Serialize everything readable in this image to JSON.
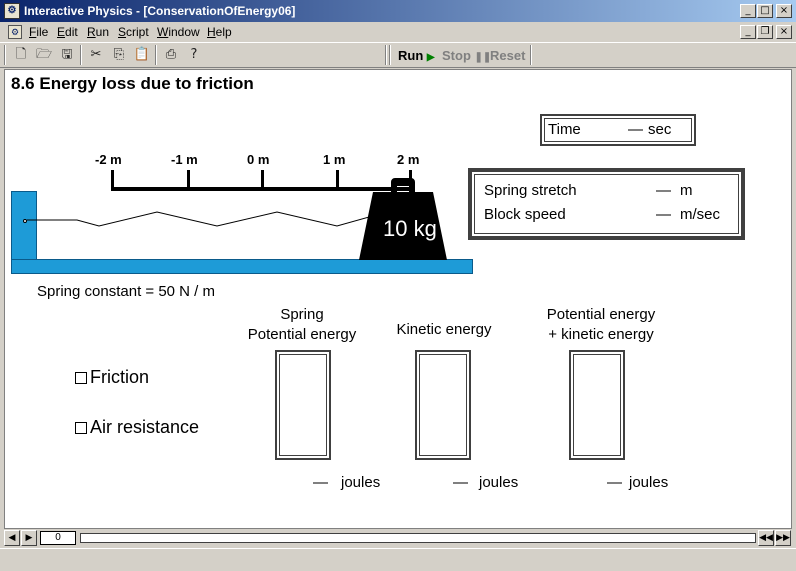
{
  "window": {
    "title": "Interactive Physics - [ConservationOfEnergy06]",
    "app_icon": "physics-app-icon",
    "controls": [
      "_",
      "□",
      "×"
    ],
    "doc_controls": [
      "_",
      "❐",
      "×"
    ]
  },
  "menu": {
    "items": [
      "File",
      "Edit",
      "Run",
      "Script",
      "Window",
      "Help"
    ]
  },
  "toolbar": {
    "icons": [
      "new-file-icon",
      "open-folder-icon",
      "save-icon",
      "cut-icon",
      "copy-icon",
      "paste-icon",
      "print-icon",
      "help-icon"
    ],
    "run_label": "Run",
    "stop_label": "Stop",
    "reset_label": "Reset",
    "run_color": "#008000",
    "disabled_color": "#808080"
  },
  "workspace": {
    "heading": "8.6 Energy loss due to friction",
    "time_meter": {
      "label": "Time",
      "value": "—",
      "unit": "sec"
    },
    "spring_meter": {
      "stretch_label": "Spring stretch",
      "stretch_value": "—",
      "stretch_unit": "m",
      "speed_label": "Block speed",
      "speed_value": "—",
      "speed_unit": "m/sec"
    },
    "ruler": {
      "labels": [
        "-2 m",
        "-1 m",
        "0 m",
        "1 m",
        "2 m"
      ]
    },
    "block": {
      "mass_label": "10 kg"
    },
    "spring_constant": "Spring constant = 50 N / m",
    "bars": [
      {
        "label_line1": "Spring",
        "label_line2": "Potential energy",
        "value": "—",
        "unit": "joules"
      },
      {
        "label_line1": "",
        "label_line2": "Kinetic energy",
        "value": "—",
        "unit": "joules"
      },
      {
        "label_line1": "Potential energy",
        "label_line2": "+ kinetic energy",
        "value": "—",
        "unit": "joules"
      }
    ],
    "checkboxes": [
      {
        "label": "Friction",
        "checked": false
      },
      {
        "label": "Air resistance",
        "checked": false
      }
    ],
    "colors": {
      "wall_floor": "#1e9bd7",
      "block": "#000000"
    }
  },
  "scrollbar": {
    "frame": "0"
  }
}
